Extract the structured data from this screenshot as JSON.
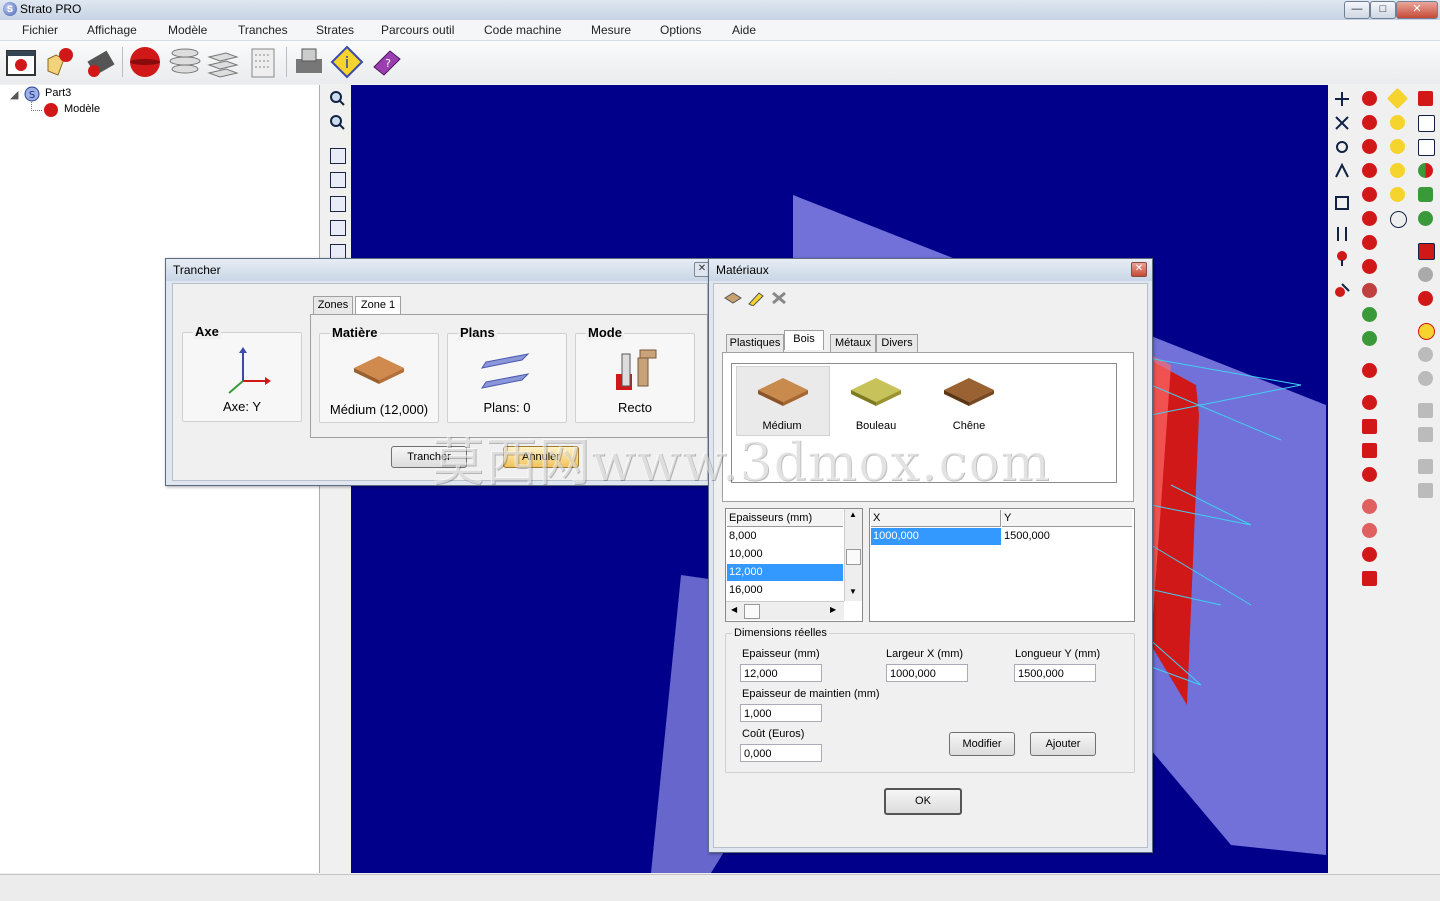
{
  "window": {
    "title": "Strato PRO",
    "minimize": "—",
    "maximize": "□",
    "close": "✕"
  },
  "menu": [
    "Fichier",
    "Affichage",
    "Modèle",
    "Tranches",
    "Strates",
    "Parcours outil",
    "Code machine",
    "Mesure",
    "Options",
    "Aide"
  ],
  "tree": {
    "root": "Part3",
    "child": "Modèle"
  },
  "trancher": {
    "title": "Trancher",
    "tabs": [
      "Zones",
      "Zone 1"
    ],
    "axe": {
      "label": "Axe",
      "value": "Axe: Y"
    },
    "matiere": {
      "label": "Matière",
      "value": "Médium (12,000)"
    },
    "plans": {
      "label": "Plans",
      "value": "Plans: 0"
    },
    "mode": {
      "label": "Mode",
      "value": "Recto"
    },
    "btn_trancher": "Trancher",
    "btn_annuler": "Annuler"
  },
  "materiaux": {
    "title": "Matériaux",
    "tabs": [
      "Plastiques",
      "Bois",
      "Métaux",
      "Divers"
    ],
    "woods": [
      "Médium",
      "Bouleau",
      "Chêne"
    ],
    "wood_colors": [
      "#c98a4e",
      "#c7c25a",
      "#9a6232"
    ],
    "epaisseurs_header": "Epaisseurs (mm)",
    "epaisseurs": [
      "8,000",
      "10,000",
      "12,000",
      "16,000"
    ],
    "xy_headers": [
      "X",
      "Y"
    ],
    "xy_row": [
      "1000,000",
      "1500,000"
    ],
    "dims_label": "Dimensions réelles",
    "epaisseur_label": "Epaisseur (mm)",
    "epaisseur_value": "12,000",
    "largeur_label": "Largeur X (mm)",
    "largeur_value": "1000,000",
    "longueur_label": "Longueur Y (mm)",
    "longueur_value": "1500,000",
    "maintien_label": "Epaisseur de maintien (mm)",
    "maintien_value": "1,000",
    "cout_label": "Coût (Euros)",
    "cout_value": "0,000",
    "btn_modifier": "Modifier",
    "btn_ajouter": "Ajouter",
    "btn_ok": "OK"
  },
  "watermark": "莫西网www.3dmox.com",
  "colors": {
    "viewport": "#00008b",
    "selection": "#3399ff",
    "model_red": "#d01818"
  }
}
